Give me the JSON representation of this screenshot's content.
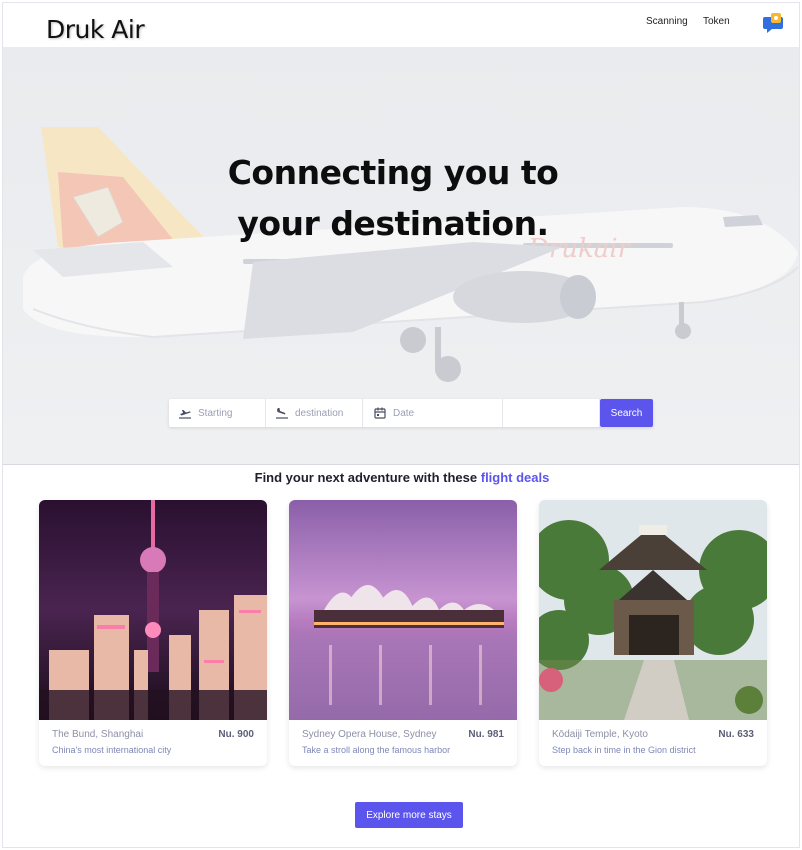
{
  "header": {
    "brand": "Druk Air",
    "nav": [
      {
        "label": "Scanning"
      },
      {
        "label": "Token"
      }
    ],
    "chat_icon": "chat-bubble-icon"
  },
  "hero": {
    "title_line1": "Connecting you to",
    "title_line2": "your destination.",
    "livery_text": "Drukair"
  },
  "search": {
    "starting_placeholder": "Starting",
    "destination_placeholder": "destination",
    "date_placeholder": "Date",
    "extra_value": "",
    "button_label": "Search",
    "icons": [
      "takeoff-icon",
      "landing-icon",
      "calendar-icon"
    ]
  },
  "deals": {
    "heading_prefix": "Find your next adventure with these",
    "heading_accent": "flight deals",
    "cards": [
      {
        "name": "The Bund, Shanghai",
        "price": "Nu. 900",
        "description": "China's most international city"
      },
      {
        "name": "Sydney Opera House, Sydney",
        "price": "Nu. 981",
        "description": "Take a stroll along the famous harbor"
      },
      {
        "name": "Kōdaiji Temple, Kyoto",
        "price": "Nu. 633",
        "description": "Step back in time in the Gion district"
      }
    ]
  },
  "explore_button": "Explore more stays",
  "colors": {
    "accent": "#5b55ee",
    "hero_bg": "#eceef1"
  }
}
